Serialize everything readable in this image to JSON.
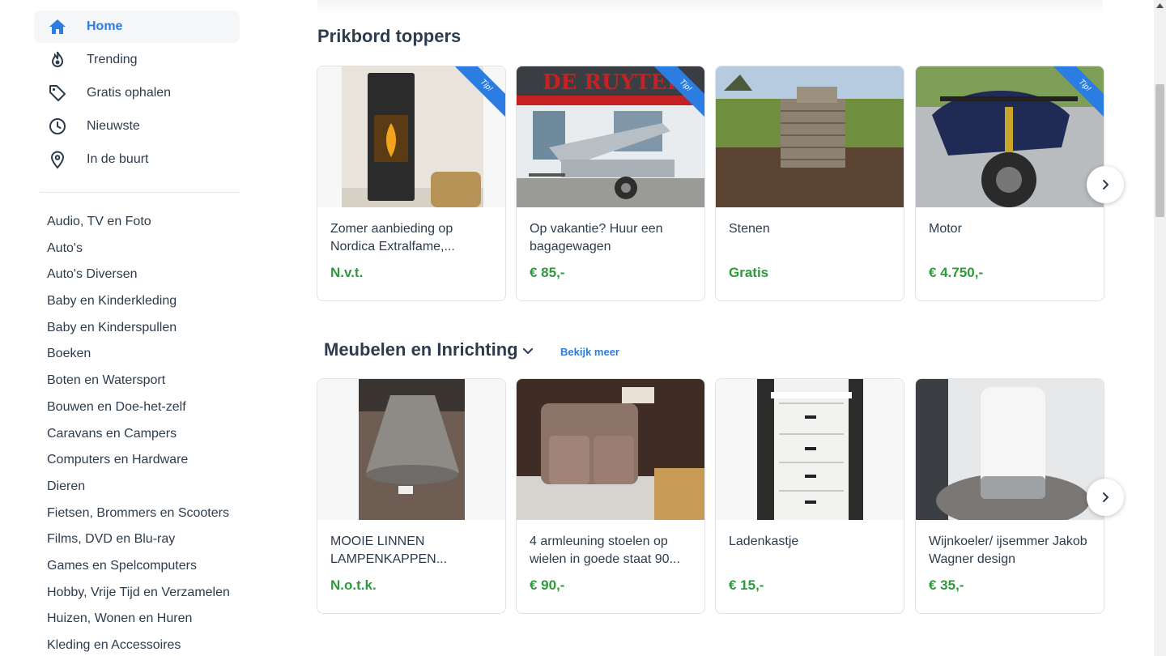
{
  "sidebar": {
    "nav": [
      {
        "label": "Home",
        "icon": "home-icon",
        "active": true
      },
      {
        "label": "Trending",
        "icon": "flame-icon",
        "active": false
      },
      {
        "label": "Gratis ophalen",
        "icon": "tag-icon",
        "active": false
      },
      {
        "label": "Nieuwste",
        "icon": "clock-icon",
        "active": false
      },
      {
        "label": "In de buurt",
        "icon": "location-pin-icon",
        "active": false
      }
    ],
    "categories": [
      "Audio, TV en Foto",
      "Auto's",
      "Auto's Diversen",
      "Baby en Kinderkleding",
      "Baby en Kinderspullen",
      "Boeken",
      "Boten en Watersport",
      "Bouwen en Doe-het-zelf",
      "Caravans en Campers",
      "Computers en Hardware",
      "Dieren",
      "Fietsen, Brommers en Scooters",
      "Films, DVD en Blu-ray",
      "Games en Spelcomputers",
      "Hobby, Vrije Tijd en Verzamelen",
      "Huizen, Wonen en Huren",
      "Kleding en Accessoires"
    ]
  },
  "sections": [
    {
      "title": "Prikbord toppers",
      "cards": [
        {
          "title": "Zomer aanbieding op Nordica Extralfame,...",
          "price": "N.v.t.",
          "tip": "Tip!",
          "image": "pellet-stove-photo"
        },
        {
          "title": "Op vakantie? Huur een bagagewagen",
          "price": "€ 85,-",
          "tip": "Tip!",
          "image": "trailer-photo",
          "sign": "DE RUYTER"
        },
        {
          "title": "Stenen",
          "price": "Gratis",
          "tip": "",
          "image": "bricks-photo"
        },
        {
          "title": "Motor",
          "price": "€ 4.750,-",
          "tip": "Tip!",
          "image": "motorcycle-photo"
        }
      ]
    },
    {
      "title": "Meubelen en Inrichting",
      "link": "Bekijk meer",
      "cards": [
        {
          "title": "MOOIE LINNEN LAMPENKAPPEN...",
          "price": "N.o.t.k.",
          "image": "lampshade-photo"
        },
        {
          "title": "4 armleuning stoelen op wielen in goede staat 90...",
          "price": "€ 90,-",
          "image": "armchairs-photo"
        },
        {
          "title": "Ladenkastje",
          "price": "€ 15,-",
          "image": "drawer-cabinet-photo"
        },
        {
          "title": "Wijnkoeler/ ijsemmer Jakob Wagner design",
          "price": "€ 35,-",
          "image": "wine-cooler-photo"
        }
      ]
    }
  ],
  "colors": {
    "accent": "#2b7de1",
    "price_green": "#2d9a3a",
    "text": "#2d3c4d"
  }
}
